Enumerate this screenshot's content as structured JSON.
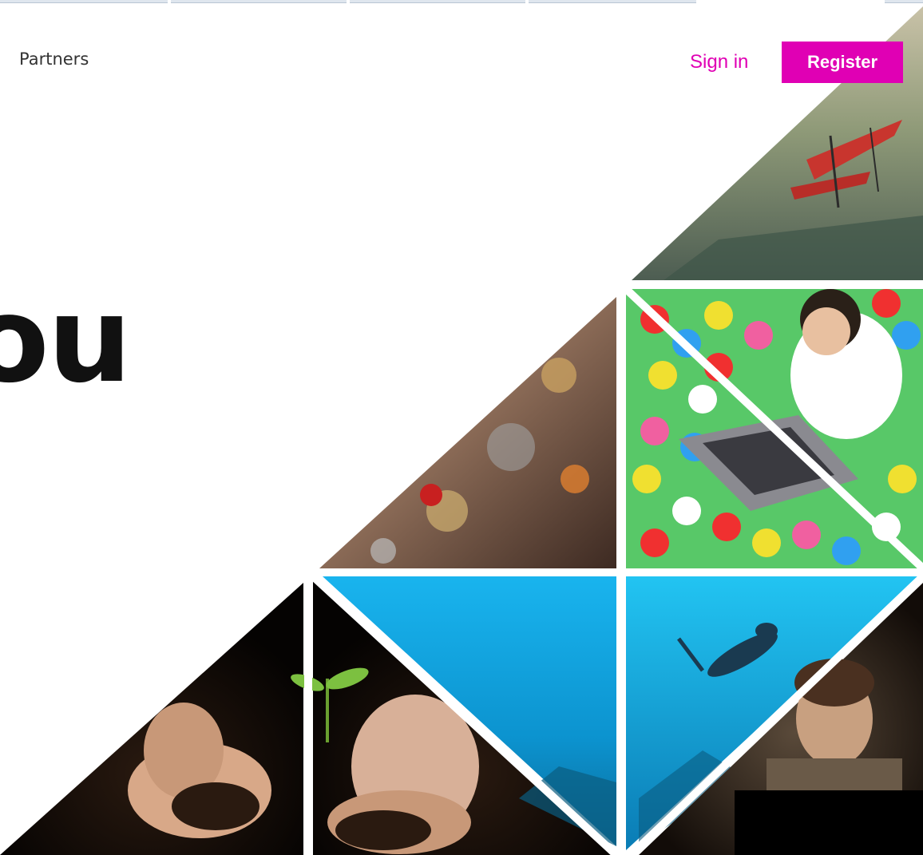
{
  "header": {
    "nav_partners": "Partners",
    "sign_in": "Sign in",
    "register": "Register"
  },
  "hero": {
    "headline_fragment": "ou"
  },
  "colors": {
    "accent": "#e000b4",
    "text": "#111111"
  },
  "mosaic": {
    "tiles": [
      "airplane-painting",
      "mosaic-art",
      "ball-pit-laptop",
      "seedling-hands",
      "soil-hands",
      "underwater-sea",
      "scuba-diver",
      "man-at-computer"
    ]
  }
}
